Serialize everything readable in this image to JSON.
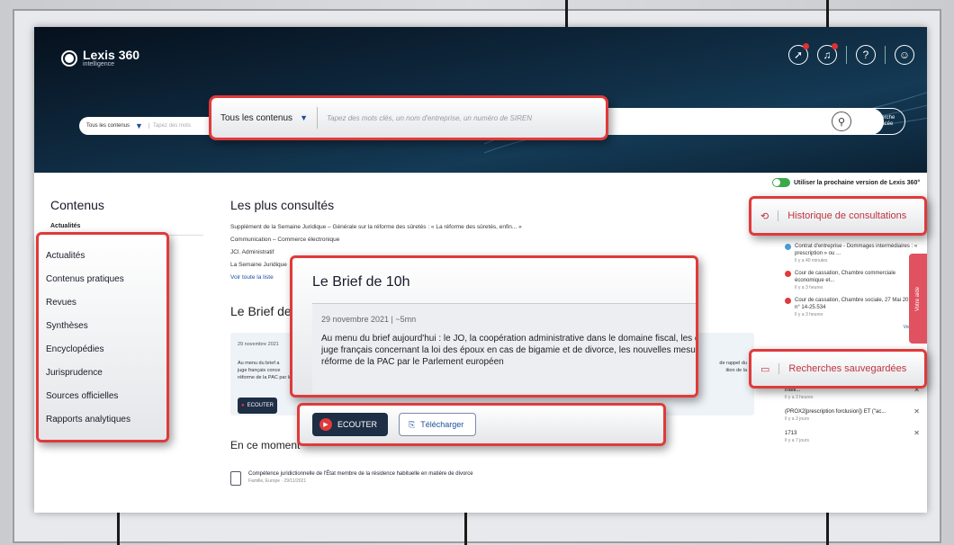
{
  "header": {
    "logo_title": "Lexis 360",
    "logo_subtitle": "intelligence",
    "small_search_select": "Tous les contenus",
    "small_search_placeholder": "Tapez des mots",
    "advanced_search": "recherche avancée",
    "toggle_label": "Utiliser la prochaine version de Lexis 360°",
    "icons": [
      "rocket-icon",
      "bell-icon",
      "help-icon",
      "user-icon"
    ]
  },
  "search_callout": {
    "select_label": "Tous les contenus",
    "placeholder": "Tapez des mots clés, un nom d'entreprise, un numéro de SIREN"
  },
  "left": {
    "title": "Contenus",
    "current": "Actualités",
    "items": [
      "Actualités",
      "Contenus pratiques",
      "Revues",
      "Synthèses",
      "Encyclopédies",
      "Jurisprudence",
      "Sources officielles",
      "Rapports analytiques"
    ]
  },
  "popular": {
    "title": "Les plus consultés",
    "items": [
      "Supplément de la Semaine Juridique – Générale sur la réforme des sûretés : « La réforme des sûretés, enfin... »",
      "Communication – Commerce électronique",
      "JCl. Administratif",
      "La Semaine Juridique"
    ],
    "see_all": "Voir toute la liste"
  },
  "brief": {
    "title": "Le Brief de 10h",
    "title_partial": "Le Brief de 1",
    "meta": "29 novembre 2021 | ~5mn",
    "meta_partial": "29 novembre 2021",
    "line1": "Au menu du brief aujourd'hui : le JO, la coopération administrative dans le domaine fiscal, les conséquences",
    "line2": "juge français concernant la loi des époux en cas de bigamie et de divorce, les nouvelles mesures de la Comm",
    "line3": "réforme de la PAC par le Parlement européen",
    "bg_line1": "Au menu du brief a",
    "bg_line2": "juge français conce",
    "bg_line3": "réforme de la PAC par le Parlement européen",
    "bg_tail1": "de rappel du",
    "bg_tail2": "ition de la",
    "listen": "ECOUTER",
    "download": "Télécharger"
  },
  "moment": {
    "title": "En ce moment",
    "article_title": "Compétence juridictionnelle de l'État membre de la résidence habituelle en matière de divorce",
    "article_meta": "Famille, Europe · 29/11/2021"
  },
  "history": {
    "title": "Historique de consultations",
    "items": [
      {
        "text": "Contrat d'entreprise - Dommages intermédiaires : « prescription » ou ...",
        "ago": "Il y a 40 minutes",
        "color": "#4a9fd8"
      },
      {
        "text": "Cour de cassation, Chambre commerciale économique et...",
        "ago": "Il y a 3 heures",
        "color": "#e03a3a"
      },
      {
        "text": "Cour de cassation, Chambre sociale, 27 Mai 2015 – n° 14-25.534",
        "ago": "Il y a 3 heures",
        "color": "#e03a3a"
      }
    ],
    "see_all": "Voir tout"
  },
  "saved": {
    "title": "Recherches sauvegardées",
    "items": [
      {
        "text": "(PROX2[prescription forclusion]) ET (\"ac...",
        "ago": "Il y a 3 jours"
      },
      {
        "text": "1713",
        "ago": "Il y a 7 jours"
      }
    ],
    "first_partial": "intell...",
    "first_ago": "Il y a 3 heures"
  },
  "help_tab": "Votre aide",
  "colors": {
    "accent_red": "#e03a3a",
    "navy": "#1d2e45",
    "link_blue": "#1b4f9c"
  }
}
